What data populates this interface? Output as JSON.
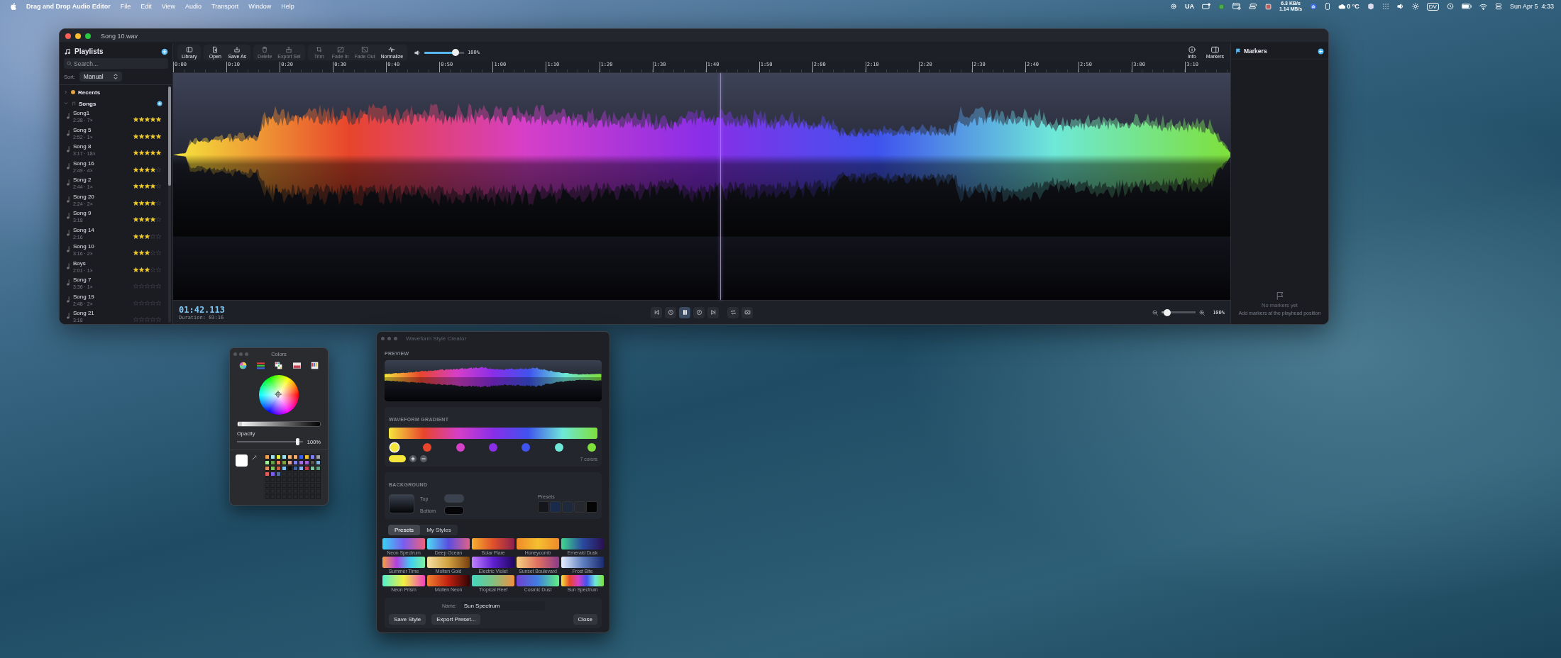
{
  "menu_bar": {
    "app_name": "Drag and Drop Audio Editor",
    "menus": [
      "File",
      "Edit",
      "View",
      "Audio",
      "Transport",
      "Window",
      "Help"
    ],
    "keyboard_layout": "UA",
    "network_speed": [
      "6.3 KB/s",
      "1.14 MB/s"
    ],
    "weather": "0 °C",
    "display_badge": "DV",
    "clock": "Sun Apr 5  4:33"
  },
  "editor": {
    "title": "Song 10.wav",
    "sidebar": {
      "title": "Playlists",
      "search_placeholder": "Search...",
      "sort_label": "Sort:",
      "sort_value": "Manual",
      "playlists": [
        {
          "name": "Recents",
          "expanded": false
        },
        {
          "name": "Songs",
          "expanded": true,
          "children": [
            {
              "name": "Song1",
              "info": "2:38 · 7×",
              "stars": 5
            },
            {
              "name": "Song 5",
              "info": "2:52 · 1×",
              "stars": 5
            },
            {
              "name": "Song 8",
              "info": "3:17 · 18×",
              "stars": 5
            },
            {
              "name": "Song 16",
              "info": "2:49 · 4×",
              "stars": 4
            },
            {
              "name": "Song 2",
              "info": "2:44 · 1×",
              "stars": 4
            },
            {
              "name": "Song 20",
              "info": "2:24 · 2×",
              "stars": 4
            },
            {
              "name": "Song 9",
              "info": "3:18",
              "stars": 4
            },
            {
              "name": "Song 14",
              "info": "2:16",
              "stars": 3
            },
            {
              "name": "Song 10",
              "info": "3:16 · 2×",
              "stars": 3
            },
            {
              "name": "Boys",
              "info": "2:01 · 1×",
              "stars": 3
            },
            {
              "name": "Song 7",
              "info": "3:36 · 1×",
              "stars": 0
            },
            {
              "name": "Song 19",
              "info": "2:48 · 2×",
              "stars": 0
            },
            {
              "name": "Song 21",
              "info": "3:18",
              "stars": 0
            }
          ]
        }
      ]
    },
    "toolbar": [
      {
        "label": "Library",
        "disabled": false
      },
      {
        "label": "Open",
        "disabled": false
      },
      {
        "label": "Save As",
        "disabled": false
      },
      {
        "label": "Delete",
        "disabled": true
      },
      {
        "label": "Export Sel",
        "disabled": true
      },
      {
        "label": "Trim",
        "disabled": true
      },
      {
        "label": "Fade In",
        "disabled": true
      },
      {
        "label": "Fade Out",
        "disabled": true
      },
      {
        "label": "Normalize",
        "disabled": false
      }
    ],
    "volume": {
      "level": 0.85,
      "reading": "100%"
    },
    "right_buttons": [
      {
        "label": "Info"
      },
      {
        "label": "Markers"
      }
    ],
    "ruler": [
      "0:00",
      "0:10",
      "0:20",
      "0:30",
      "0:40",
      "0:50",
      "1:00",
      "1:10",
      "1:20",
      "1:30",
      "1:40",
      "1:50",
      "2:00",
      "2:10",
      "2:20",
      "2:30",
      "2:40",
      "2:50",
      "3:00",
      "3:10"
    ],
    "playhead": {
      "level": 0.518
    },
    "time": "01:42.113",
    "duration": "Duration: 03:16",
    "transport": [
      {
        "selected": false
      },
      {
        "selected": false
      },
      {
        "selected": true
      },
      {
        "selected": false
      },
      {
        "selected": false
      },
      {
        "selected": false
      },
      {
        "selected": false
      }
    ],
    "zoom": {
      "level": 0.08,
      "reading": "100%"
    },
    "markers": {
      "title": "Markers",
      "empty_title": "No markers yet",
      "empty_hint": "Add markers at the playhead position"
    }
  },
  "colors_panel": {
    "title": "Colors",
    "brightness": {
      "level": 0.02
    },
    "opacity_label": "Opacity",
    "opacity": {
      "level": 0.95,
      "reading": "100%"
    }
  },
  "style_creator": {
    "title": "Waveform Style Creator",
    "preview_label": "PREVIEW",
    "gradient_label": "WAVEFORM GRADIENT",
    "stops": [
      {
        "color": "#f5e63c",
        "selected": true
      },
      {
        "color": "#e8452c",
        "selected": false
      },
      {
        "color": "#d63fc8",
        "selected": false
      },
      {
        "color": "#8a2ee8",
        "selected": false
      },
      {
        "color": "#3f53ee",
        "selected": false
      },
      {
        "color": "#6ee8d8",
        "selected": false
      },
      {
        "color": "#7ee03a",
        "selected": false
      }
    ],
    "stop_count": "7 colors",
    "background_label": "BACKGROUND",
    "background_colors": [
      {
        "label": "Top",
        "color": "#3a4250"
      },
      {
        "label": "Bottom",
        "color": "#050507"
      }
    ],
    "background_presets_label": "Presets",
    "background_presets": [
      {
        "color": "#14161c"
      },
      {
        "color": "#1a2a4a"
      },
      {
        "color": "#1e2a3c"
      },
      {
        "color": "#25282e"
      },
      {
        "color": "#050505"
      }
    ],
    "tabs": [
      {
        "label": "Presets",
        "selected": true
      },
      {
        "label": "My Styles",
        "selected": false
      }
    ],
    "presets": [
      {
        "name": "Neon Spectrum"
      },
      {
        "name": "Deep Ocean"
      },
      {
        "name": "Solar Flare"
      },
      {
        "name": "Honeycomb"
      },
      {
        "name": "Emerald Dusk"
      },
      {
        "name": "Summer Time"
      },
      {
        "name": "Molten Gold"
      },
      {
        "name": "Electric Violet"
      },
      {
        "name": "Sunset Boulevard"
      },
      {
        "name": "Frost Bite"
      },
      {
        "name": "Neon Prism"
      },
      {
        "name": "Molten Neon"
      },
      {
        "name": "Tropical Reef"
      },
      {
        "name": "Cosmic Dust"
      },
      {
        "name": "Sun Spectrum"
      }
    ],
    "name_label": "Name:",
    "name_value": "Sun Spectrum",
    "buttons": [
      "Save Style",
      "Export Preset...",
      "Close"
    ]
  }
}
